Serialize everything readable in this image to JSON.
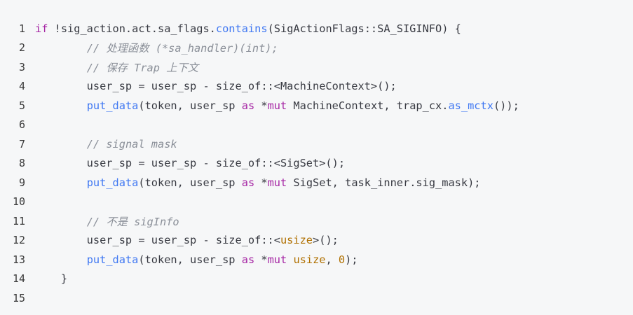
{
  "code_block": {
    "lines": [
      {
        "num": "1",
        "tokens": [
          {
            "t": "if",
            "c": "kw"
          },
          {
            "t": " !sig_action.act.sa_flags.",
            "c": "plain"
          },
          {
            "t": "contains",
            "c": "fn"
          },
          {
            "t": "(SigActionFlags::SA_SIGINFO) {",
            "c": "plain"
          }
        ]
      },
      {
        "num": "2",
        "tokens": [
          {
            "t": "        ",
            "c": "plain"
          },
          {
            "t": "// 处理函数 (*sa_handler)(int);",
            "c": "cm"
          }
        ]
      },
      {
        "num": "3",
        "tokens": [
          {
            "t": "        ",
            "c": "plain"
          },
          {
            "t": "// 保存 Trap 上下文",
            "c": "cm"
          }
        ]
      },
      {
        "num": "4",
        "tokens": [
          {
            "t": "        user_sp = user_sp - size_of::<MachineContext>();",
            "c": "plain"
          }
        ]
      },
      {
        "num": "5",
        "tokens": [
          {
            "t": "        ",
            "c": "plain"
          },
          {
            "t": "put_data",
            "c": "fn"
          },
          {
            "t": "(token, user_sp ",
            "c": "plain"
          },
          {
            "t": "as",
            "c": "kw"
          },
          {
            "t": " *",
            "c": "plain"
          },
          {
            "t": "mut",
            "c": "kw"
          },
          {
            "t": " MachineContext, trap_cx.",
            "c": "plain"
          },
          {
            "t": "as_mctx",
            "c": "fn"
          },
          {
            "t": "());",
            "c": "plain"
          }
        ]
      },
      {
        "num": "6",
        "tokens": []
      },
      {
        "num": "7",
        "tokens": [
          {
            "t": "        ",
            "c": "plain"
          },
          {
            "t": "// signal mask",
            "c": "cm"
          }
        ]
      },
      {
        "num": "8",
        "tokens": [
          {
            "t": "        user_sp = user_sp - size_of::<SigSet>();",
            "c": "plain"
          }
        ]
      },
      {
        "num": "9",
        "tokens": [
          {
            "t": "        ",
            "c": "plain"
          },
          {
            "t": "put_data",
            "c": "fn"
          },
          {
            "t": "(token, user_sp ",
            "c": "plain"
          },
          {
            "t": "as",
            "c": "kw"
          },
          {
            "t": " *",
            "c": "plain"
          },
          {
            "t": "mut",
            "c": "kw"
          },
          {
            "t": " SigSet, task_inner.sig_mask);",
            "c": "plain"
          }
        ]
      },
      {
        "num": "10",
        "tokens": []
      },
      {
        "num": "11",
        "tokens": [
          {
            "t": "        ",
            "c": "plain"
          },
          {
            "t": "// 不是 sigInfo",
            "c": "cm"
          }
        ]
      },
      {
        "num": "12",
        "tokens": [
          {
            "t": "        user_sp = user_sp - size_of::<",
            "c": "plain"
          },
          {
            "t": "usize",
            "c": "ty"
          },
          {
            "t": ">();",
            "c": "plain"
          }
        ]
      },
      {
        "num": "13",
        "tokens": [
          {
            "t": "        ",
            "c": "plain"
          },
          {
            "t": "put_data",
            "c": "fn"
          },
          {
            "t": "(token, user_sp ",
            "c": "plain"
          },
          {
            "t": "as",
            "c": "kw"
          },
          {
            "t": " *",
            "c": "plain"
          },
          {
            "t": "mut",
            "c": "kw"
          },
          {
            "t": " ",
            "c": "plain"
          },
          {
            "t": "usize",
            "c": "ty"
          },
          {
            "t": ", ",
            "c": "plain"
          },
          {
            "t": "0",
            "c": "num"
          },
          {
            "t": ");",
            "c": "plain"
          }
        ]
      },
      {
        "num": "14",
        "tokens": [
          {
            "t": "    }",
            "c": "plain"
          }
        ]
      },
      {
        "num": "15",
        "tokens": []
      }
    ]
  },
  "colors": {
    "background": "#f6f7f8",
    "keyword": "#a626a4",
    "function": "#4078f2",
    "comment": "#8a8f98",
    "type_number": "#b07000",
    "text": "#383a42"
  }
}
